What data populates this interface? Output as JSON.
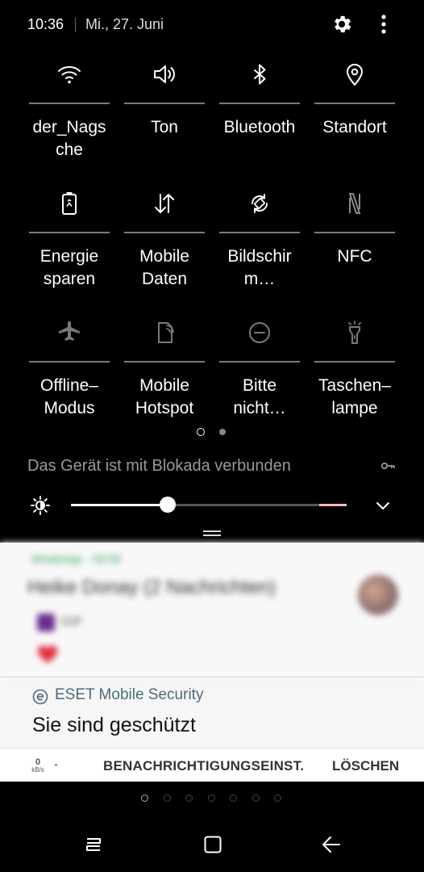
{
  "status_bar": {
    "time": "10:36",
    "date": "Mi., 27. Juni"
  },
  "quick_toggles": [
    {
      "label": "der_Nags\nche",
      "icon": "wifi-icon",
      "state": "on"
    },
    {
      "label": "Ton",
      "icon": "sound-icon",
      "state": "on"
    },
    {
      "label": "Bluetooth",
      "icon": "bluetooth-icon",
      "state": "on"
    },
    {
      "label": "Standort",
      "icon": "location-icon",
      "state": "on"
    },
    {
      "label": "Energie\nsparen",
      "icon": "power-saving-icon",
      "state": "on"
    },
    {
      "label": "Mobile\nDaten",
      "icon": "mobile-data-icon",
      "state": "on"
    },
    {
      "label": "Bildschir\nm…",
      "icon": "auto-rotate-icon",
      "state": "on"
    },
    {
      "label": "NFC",
      "icon": "nfc-icon",
      "state": "off"
    },
    {
      "label": "Offline–\nModus",
      "icon": "airplane-icon",
      "state": "off"
    },
    {
      "label": "Mobile\nHotspot",
      "icon": "hotspot-icon",
      "state": "off"
    },
    {
      "label": "Bitte\nnicht…",
      "icon": "do-not-disturb-icon",
      "state": "off"
    },
    {
      "label": "Taschen–\nlampe",
      "icon": "flashlight-icon",
      "state": "off"
    }
  ],
  "vpn_text": "Das Gerät ist mit Blokada verbunden",
  "brightness": {
    "level": 0.35
  },
  "notifications": {
    "whatsapp": {
      "app": "WhatsApp",
      "time": "09:58",
      "title": "Heike Donay (2 Nachrichten)",
      "line1": "GIF"
    },
    "eset": {
      "app": "ESET Mobile Security",
      "message": "Sie sind geschützt"
    }
  },
  "action_bar": {
    "speed_value": "0",
    "speed_unit": "kB/s",
    "settings_label": "BENACHRICHTIGUNGSEINST.",
    "clear_label": "LÖSCHEN"
  },
  "home_pages": {
    "count": 7,
    "current": 0
  },
  "colors": {
    "panel_bg": "#000000",
    "accent_whatsapp": "#2e9e58",
    "eset_text": "#4d6b7a"
  }
}
